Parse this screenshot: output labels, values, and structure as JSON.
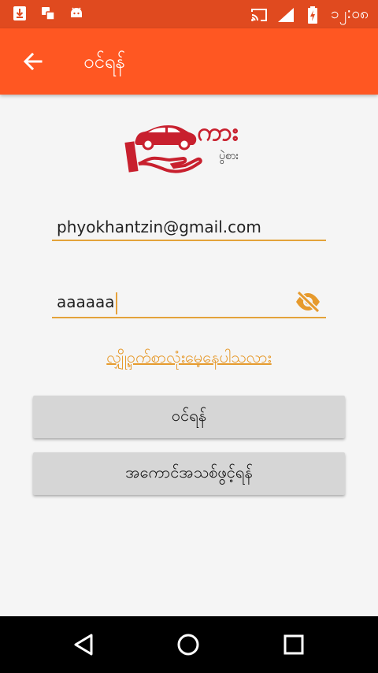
{
  "status_bar": {
    "time": "၁၂:၀၈"
  },
  "app_bar": {
    "title": "ဝင်ရန်"
  },
  "logo": {
    "main_text": "ကား",
    "sub_text": "ပွဲစား"
  },
  "login_form": {
    "email_value": "phyokhantzin@gmail.com",
    "password_value": "aaaaaa",
    "forgot_password_label": "လျှို့ဝှက်စာလုံးမေ့နေပါသလား",
    "login_button_label": "ဝင်ရန်",
    "register_button_label": "အကောင်အသစ်ဖွင့်ရန်"
  },
  "colors": {
    "status_bar": "#e04a1f",
    "app_bar": "#ff5722",
    "accent": "#e69a2d",
    "logo_red": "#c8202e"
  }
}
